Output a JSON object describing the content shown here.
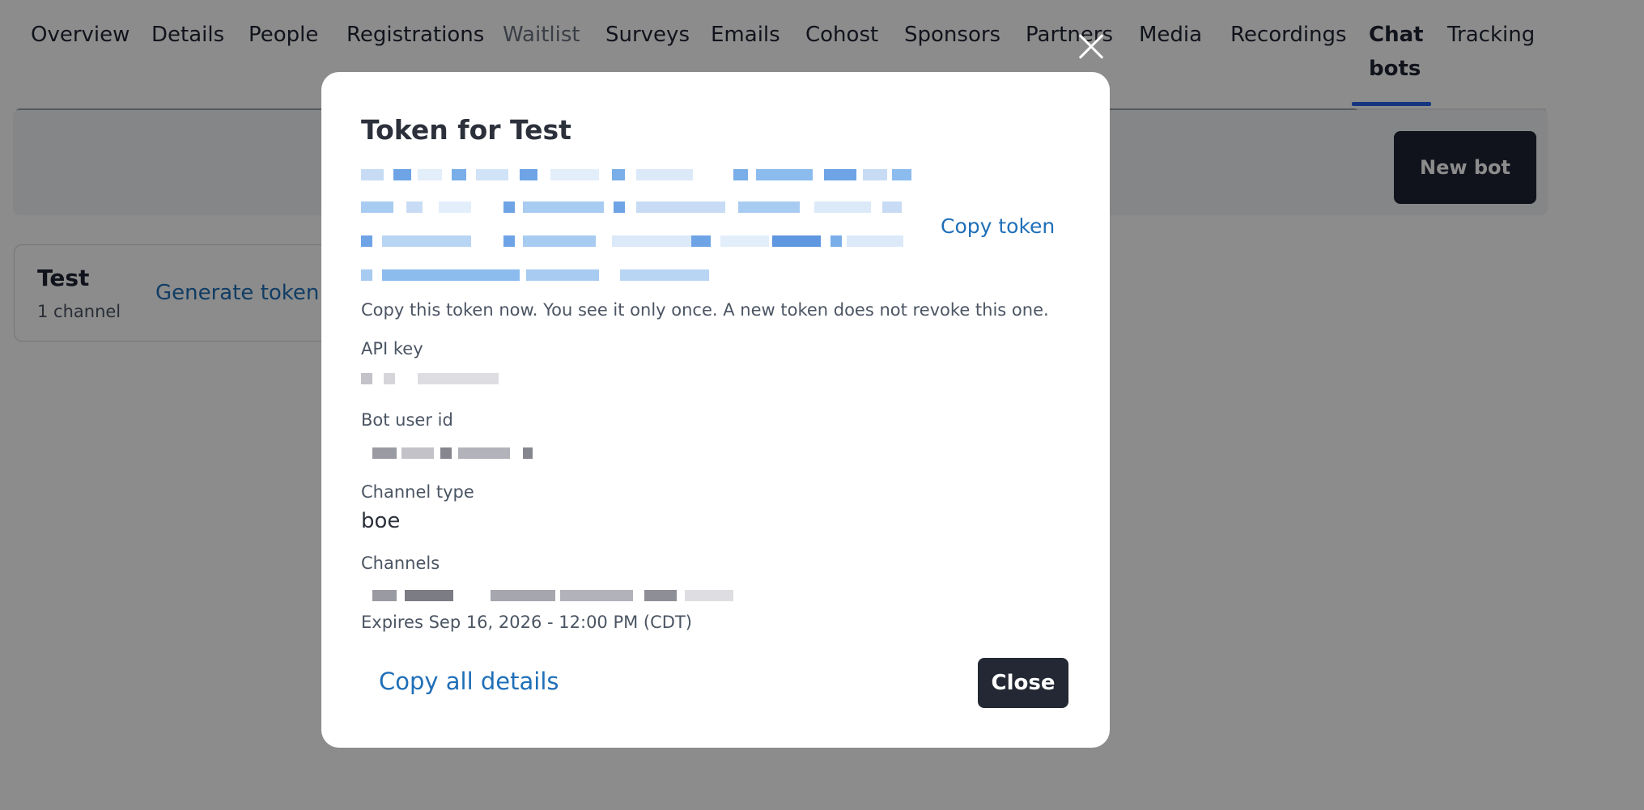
{
  "nav": {
    "items": [
      "Overview",
      "Details",
      "People",
      "Registrations",
      "Waitlist",
      "Surveys",
      "Emails",
      "Cohost",
      "Sponsors",
      "Partners",
      "Media",
      "Recordings",
      "Chat",
      "Tracking"
    ],
    "active_second_line": "bots"
  },
  "toolbar": {
    "new_bot_label": "New bot"
  },
  "bot_card": {
    "name": "Test",
    "channels": "1 channel",
    "generate_token_label": "Generate token"
  },
  "modal": {
    "title": "Token for Test",
    "copy_token_label": "Copy token",
    "note": "Copy this token now. You see it only once. A new token does not revoke this one.",
    "fields": {
      "api_key_label": "API key",
      "bot_user_id_label": "Bot user id",
      "channel_type_label": "Channel type",
      "channel_type_value": "boe",
      "channels_label": "Channels"
    },
    "expires": "Expires Sep 16, 2026 - 12:00 PM (CDT)",
    "copy_all_label": "Copy all details",
    "close_label": "Close"
  },
  "colors": {
    "accent": "#1f6fb8",
    "active_tab": "#2563eb",
    "dark_button": "#232834"
  }
}
